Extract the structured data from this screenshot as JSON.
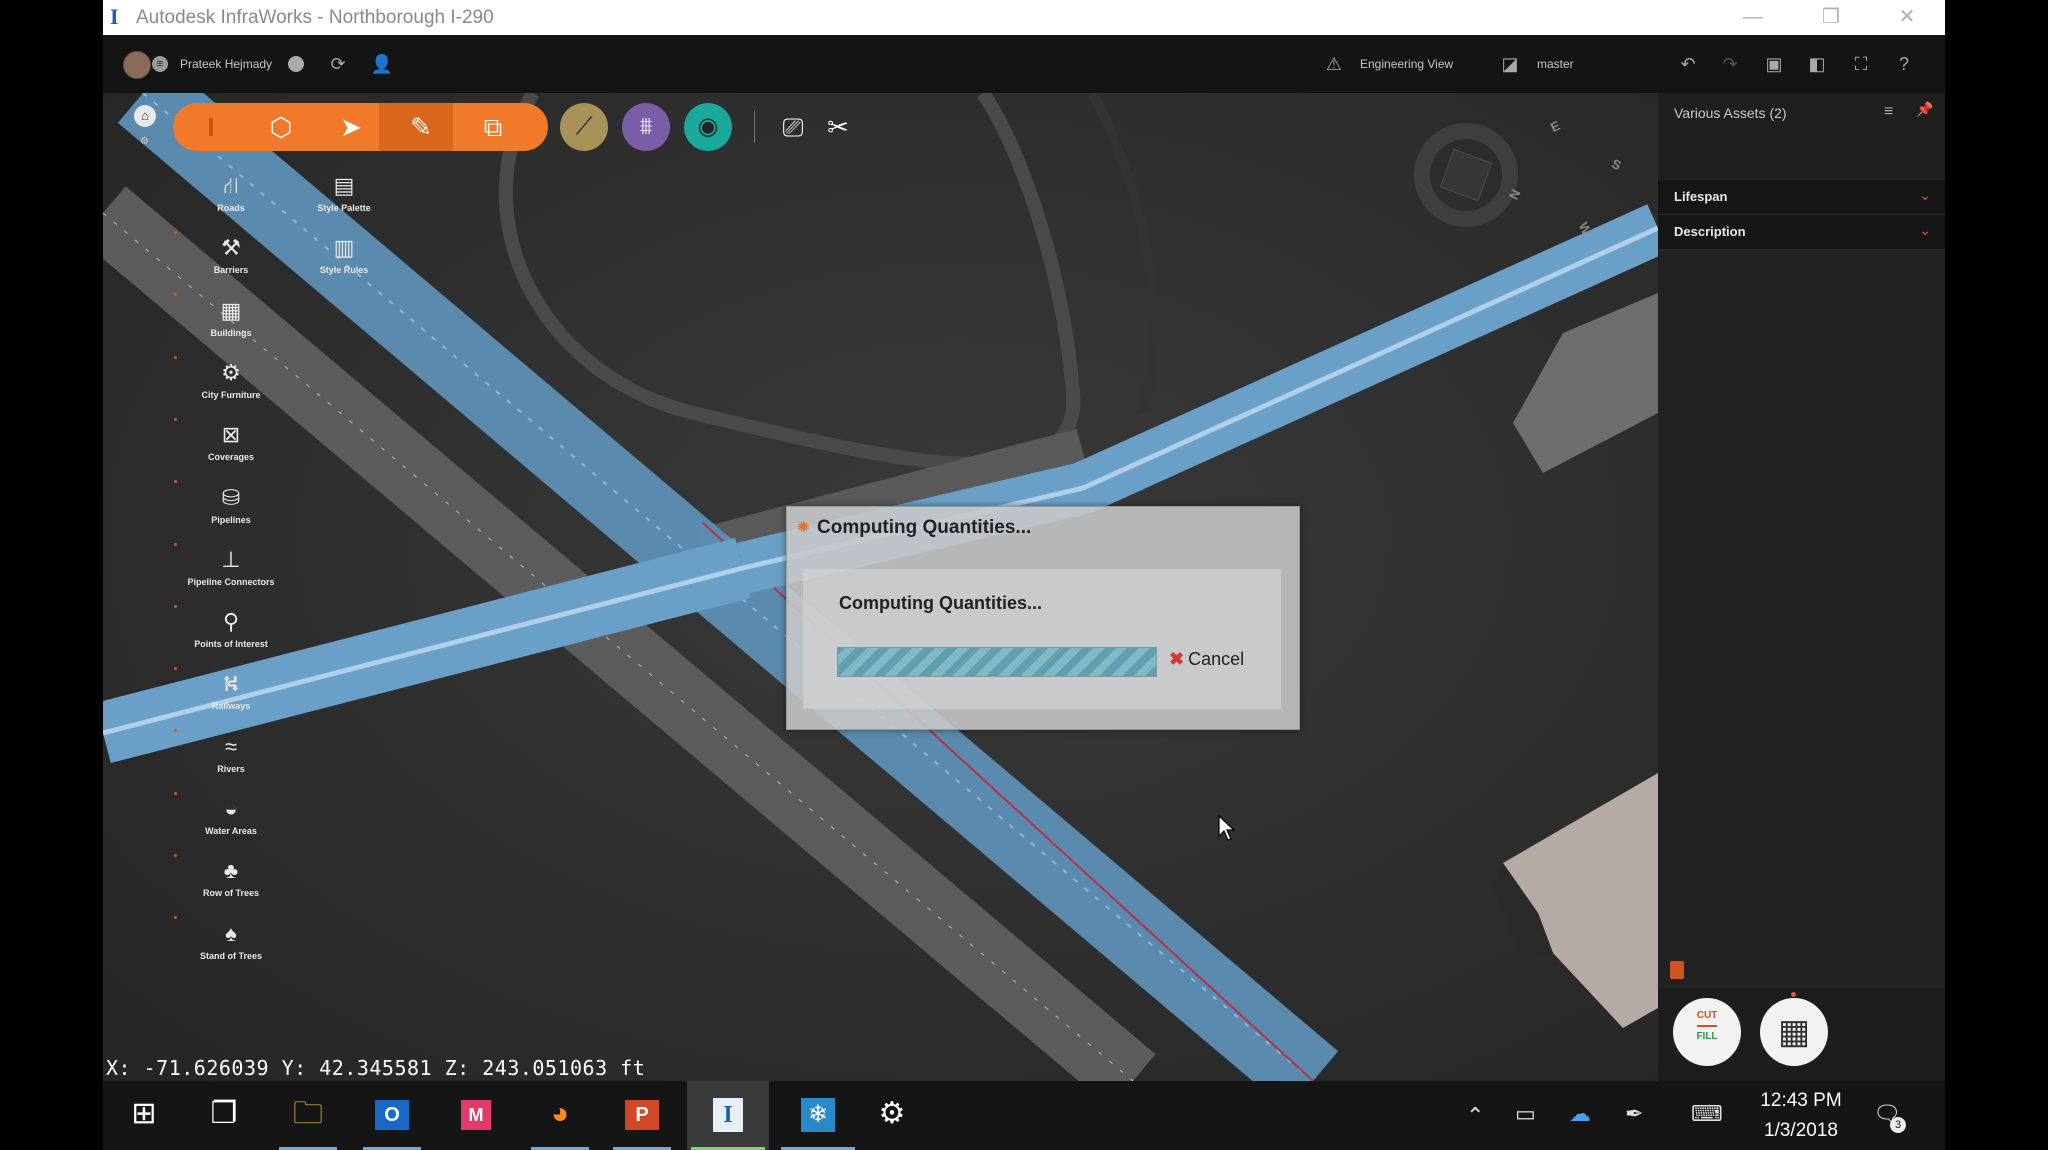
{
  "window": {
    "app_icon": "I",
    "title": "Autodesk InfraWorks - Northborough I-290",
    "controls": {
      "minimize": "—",
      "restore": "❐",
      "close": "✕"
    }
  },
  "header": {
    "user_name": "Prateek Hejmady",
    "view_mode": "Engineering View",
    "branch": "master"
  },
  "toolbar": {
    "icons": [
      "infraworks-icon",
      "components-icon",
      "select-icon",
      "sketch-icon",
      "clone-icon",
      "roads-analysis-icon",
      "bridge-icon",
      "drainage-icon",
      "present-icon",
      "settings-icon"
    ]
  },
  "palette": {
    "items": [
      {
        "label": "Roads",
        "icon": "road-icon",
        "glyph": "⛙"
      },
      {
        "label": "Barriers",
        "icon": "barrier-icon",
        "glyph": "⚒"
      },
      {
        "label": "Buildings",
        "icon": "building-icon",
        "glyph": "▦"
      },
      {
        "label": "City Furniture",
        "icon": "city-furniture-icon",
        "glyph": "⚙"
      },
      {
        "label": "Coverages",
        "icon": "coverage-icon",
        "glyph": "⊠"
      },
      {
        "label": "Pipelines",
        "icon": "pipeline-icon",
        "glyph": "⛁"
      },
      {
        "label": "Pipeline Connectors",
        "icon": "pipeline-connector-icon",
        "glyph": "⊥"
      },
      {
        "label": "Points of Interest",
        "icon": "poi-icon",
        "glyph": "⚲"
      },
      {
        "label": "Railways",
        "icon": "railway-icon",
        "glyph": "⛕"
      },
      {
        "label": "Rivers",
        "icon": "river-icon",
        "glyph": "≈"
      },
      {
        "label": "Water Areas",
        "icon": "water-area-icon",
        "glyph": "◒"
      },
      {
        "label": "Row of Trees",
        "icon": "row-of-trees-icon",
        "glyph": "♣"
      },
      {
        "label": "Stand of Trees",
        "icon": "stand-of-trees-icon",
        "glyph": "♠"
      }
    ],
    "style_items": [
      {
        "label": "Style Palette",
        "icon": "style-palette-icon",
        "glyph": "▤"
      },
      {
        "label": "Style Rules",
        "icon": "style-rules-icon",
        "glyph": "▥"
      }
    ]
  },
  "compass": {
    "n": "N",
    "e": "E",
    "s": "S",
    "w": "W"
  },
  "dialog": {
    "title": "Computing Quantities...",
    "message": "Computing Quantities...",
    "progress": 1.0,
    "cancel_label": "Cancel"
  },
  "status": {
    "coordinates": "X: -71.626039 Y: 42.345581 Z: 243.051063 ft"
  },
  "right_panel": {
    "title": "Various Assets (2)",
    "sections": [
      "Lifespan",
      "Description"
    ],
    "cut_label": "CUT",
    "fill_label": "FILL"
  },
  "taskbar": {
    "apps": [
      "windows-start",
      "task-view",
      "file-explorer",
      "outlook",
      "mindmanager",
      "firefox",
      "powerpoint",
      "infraworks",
      "snowflake-app",
      "settings"
    ],
    "time": "12:43 PM",
    "date": "1/3/2018",
    "notification_count": "3"
  },
  "colors": {
    "accent_orange": "#f07a2a",
    "road_blue": "#6a9fc8",
    "panel_dark": "#222222"
  }
}
